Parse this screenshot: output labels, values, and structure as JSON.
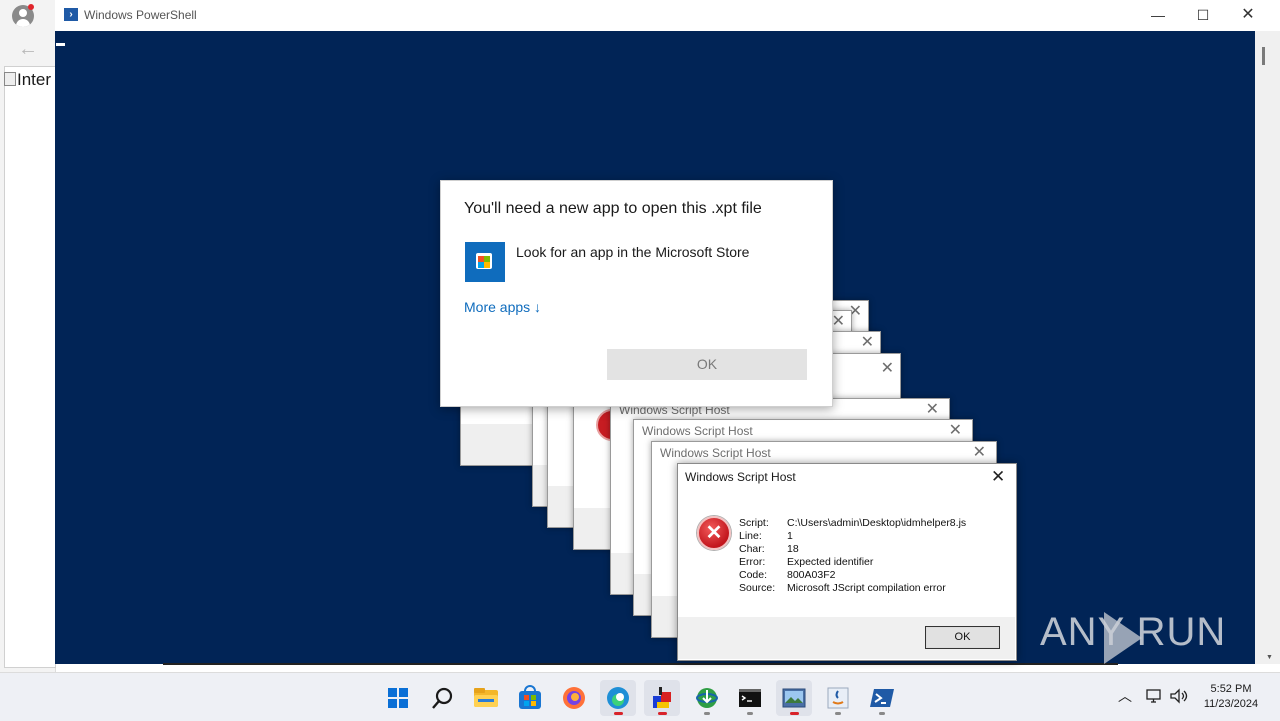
{
  "powershell": {
    "title": "Windows PowerShell",
    "minimize": "—",
    "maximize": "☐",
    "close": "✕"
  },
  "browser": {
    "broken_image_alt": "Inter"
  },
  "open_with_dialog": {
    "title": "You'll need a new app to open this .xpt file",
    "store_option": "Look for an app in the Microsoft Store",
    "more_apps": "More apps ↓",
    "ok": "OK"
  },
  "script_host_stack": [
    {
      "title": "Windows Script Host"
    },
    {
      "title": "Windows Script Host"
    },
    {
      "title": "Windows Script Host"
    }
  ],
  "script_host_main": {
    "title": "Windows Script Host",
    "close": "✕",
    "fields": [
      {
        "key": "Script:",
        "value": "C:\\Users\\admin\\Desktop\\idmhelper8.js"
      },
      {
        "key": "Line:",
        "value": "1"
      },
      {
        "key": "Char:",
        "value": "18"
      },
      {
        "key": "Error:",
        "value": "Expected identifier"
      },
      {
        "key": "Code:",
        "value": "800A03F2"
      },
      {
        "key": "Source:",
        "value": "Microsoft JScript compilation error"
      }
    ],
    "ok": "OK"
  },
  "watermark": "ANY RUN",
  "taskbar": {
    "icons": [
      "windows-start-icon",
      "search-icon",
      "file-explorer-icon",
      "microsoft-store-icon",
      "firefox-icon",
      "edge-icon",
      "paint-app-icon",
      "internet-download-icon",
      "cmd-icon",
      "image-viewer-icon",
      "java-icon",
      "powershell-icon"
    ],
    "time": "5:52 PM",
    "date": "11/23/2024"
  }
}
